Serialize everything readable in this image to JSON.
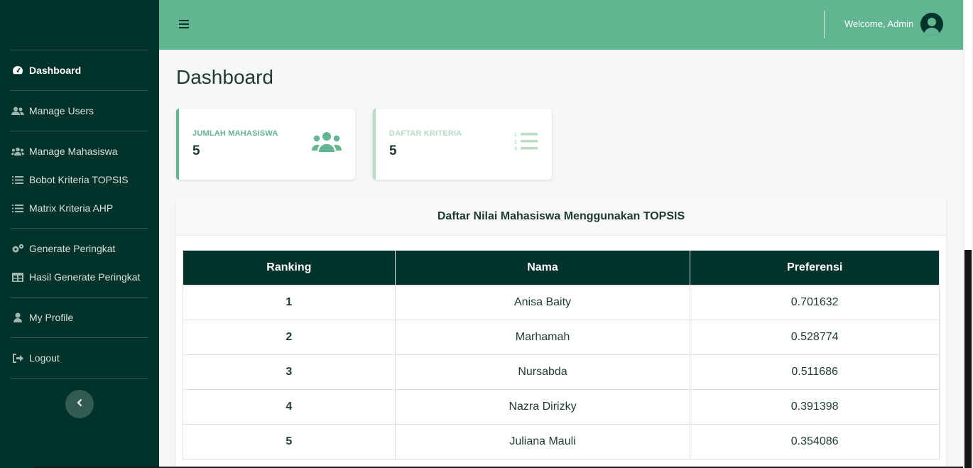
{
  "sidebar": {
    "items": [
      {
        "label": "Dashboard",
        "icon": "tachometer-icon",
        "active": true
      },
      {
        "label": "Manage Users",
        "icon": "users-icon"
      },
      {
        "label": "Manage Mahasiswa",
        "icon": "users-group-icon"
      },
      {
        "label": "Bobot Kriteria TOPSIS",
        "icon": "list-icon"
      },
      {
        "label": "Matrix Kriteria AHP",
        "icon": "list-icon"
      },
      {
        "label": "Generate Peringkat",
        "icon": "cogs-icon"
      },
      {
        "label": "Hasil Generate Peringkat",
        "icon": "table-icon"
      },
      {
        "label": "My Profile",
        "icon": "user-icon"
      },
      {
        "label": "Logout",
        "icon": "sign-out-icon"
      }
    ]
  },
  "topbar": {
    "welcome": "Welcome, Admin"
  },
  "page": {
    "title": "Dashboard"
  },
  "cards": [
    {
      "label": "JUMLAH MAHASISWA",
      "value": "5",
      "accent_color": "#61b591",
      "icon": "users-icon"
    },
    {
      "label": "DAFTAR KRITERIA",
      "value": "5",
      "accent_color": "#b7dcc0",
      "icon": "list-ol-icon"
    }
  ],
  "table": {
    "title": "Daftar Nilai Mahasiswa Menggunakan TOPSIS",
    "columns": [
      "Ranking",
      "Nama",
      "Preferensi"
    ],
    "rows": [
      [
        "1",
        "Anisa Baity",
        "0.701632"
      ],
      [
        "2",
        "Marhamah",
        "0.528774"
      ],
      [
        "3",
        "Nursabda",
        "0.511686"
      ],
      [
        "4",
        "Nazra Dirizky",
        "0.391398"
      ],
      [
        "5",
        "Juliana Mauli",
        "0.354086"
      ]
    ]
  },
  "colors": {
    "sidebar_bg": "#01332a",
    "topbar_bg": "#61b591",
    "table_header_bg": "#01332a"
  }
}
